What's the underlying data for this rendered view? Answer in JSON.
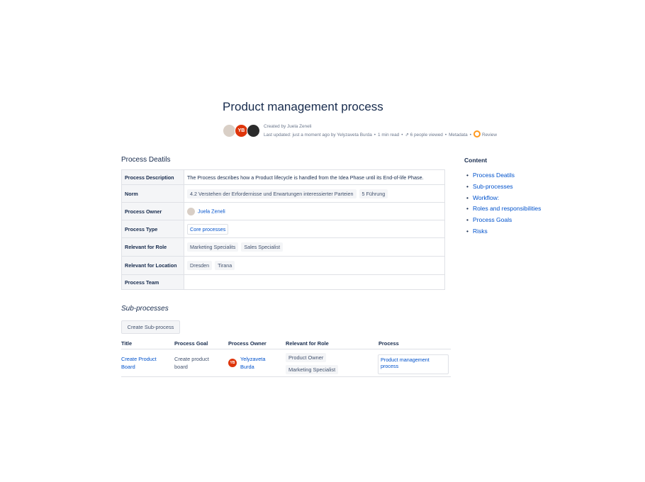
{
  "page": {
    "title": "Product management process",
    "byline": {
      "created_by": "Created by Juela Zeneli",
      "last_updated": "Last updated: just a moment ago by Yelyzaveta Burda",
      "read_time": "1 min read",
      "views": "6 people viewed",
      "metadata": "Metadata",
      "review": "Review",
      "avatar_initials": "YB"
    }
  },
  "details": {
    "heading": "Process Deatils",
    "rows": {
      "description": {
        "label": "Process Description",
        "value": "The Process describes how a Product lifecycle is handled from the Idea Phase until its End-of-life Phase."
      },
      "norm": {
        "label": "Norm",
        "tags": [
          "4.2 Verstehen der Erfordernisse und Erwartungen interessierter Parteien",
          "5 Führung"
        ]
      },
      "owner": {
        "label": "Process Owner",
        "value": "Juela Zeneli"
      },
      "type": {
        "label": "Process Type",
        "value": "Core processes"
      },
      "role": {
        "label": "Relevant for Role",
        "tags": [
          "Marketing Specialits",
          "Sales Specialist"
        ]
      },
      "location": {
        "label": "Relevant for Location",
        "tags": [
          "Dresden",
          "Tirana"
        ]
      },
      "team": {
        "label": "Process Team",
        "value": ""
      }
    }
  },
  "toc": {
    "heading": "Content",
    "items": [
      "Process Deatils",
      "Sub-processes",
      "Workflow:",
      "Roles and responsibilities",
      "Process Goals",
      "Risks"
    ]
  },
  "subprocesses": {
    "heading": "Sub-processes",
    "create_button": "Create Sub-process",
    "columns": [
      "Title",
      "Process Goal",
      "Process Owner",
      "Relevant for Role",
      "Process"
    ],
    "row": {
      "title_line1": "Create Product",
      "title_line2": "Board",
      "goal_line1": "Create product",
      "goal_line2": "board",
      "owner_initials": "YB",
      "owner_line1": "Yelyzaveta",
      "owner_line2": "Burda",
      "roles": [
        "Product Owner",
        "Marketing Specialist"
      ],
      "process_line1": "Product management",
      "process_line2": "process"
    }
  },
  "colors": {
    "link": "#0052cc",
    "text": "#172b4d",
    "review": "#ff991f",
    "avatar": "#de350b"
  }
}
